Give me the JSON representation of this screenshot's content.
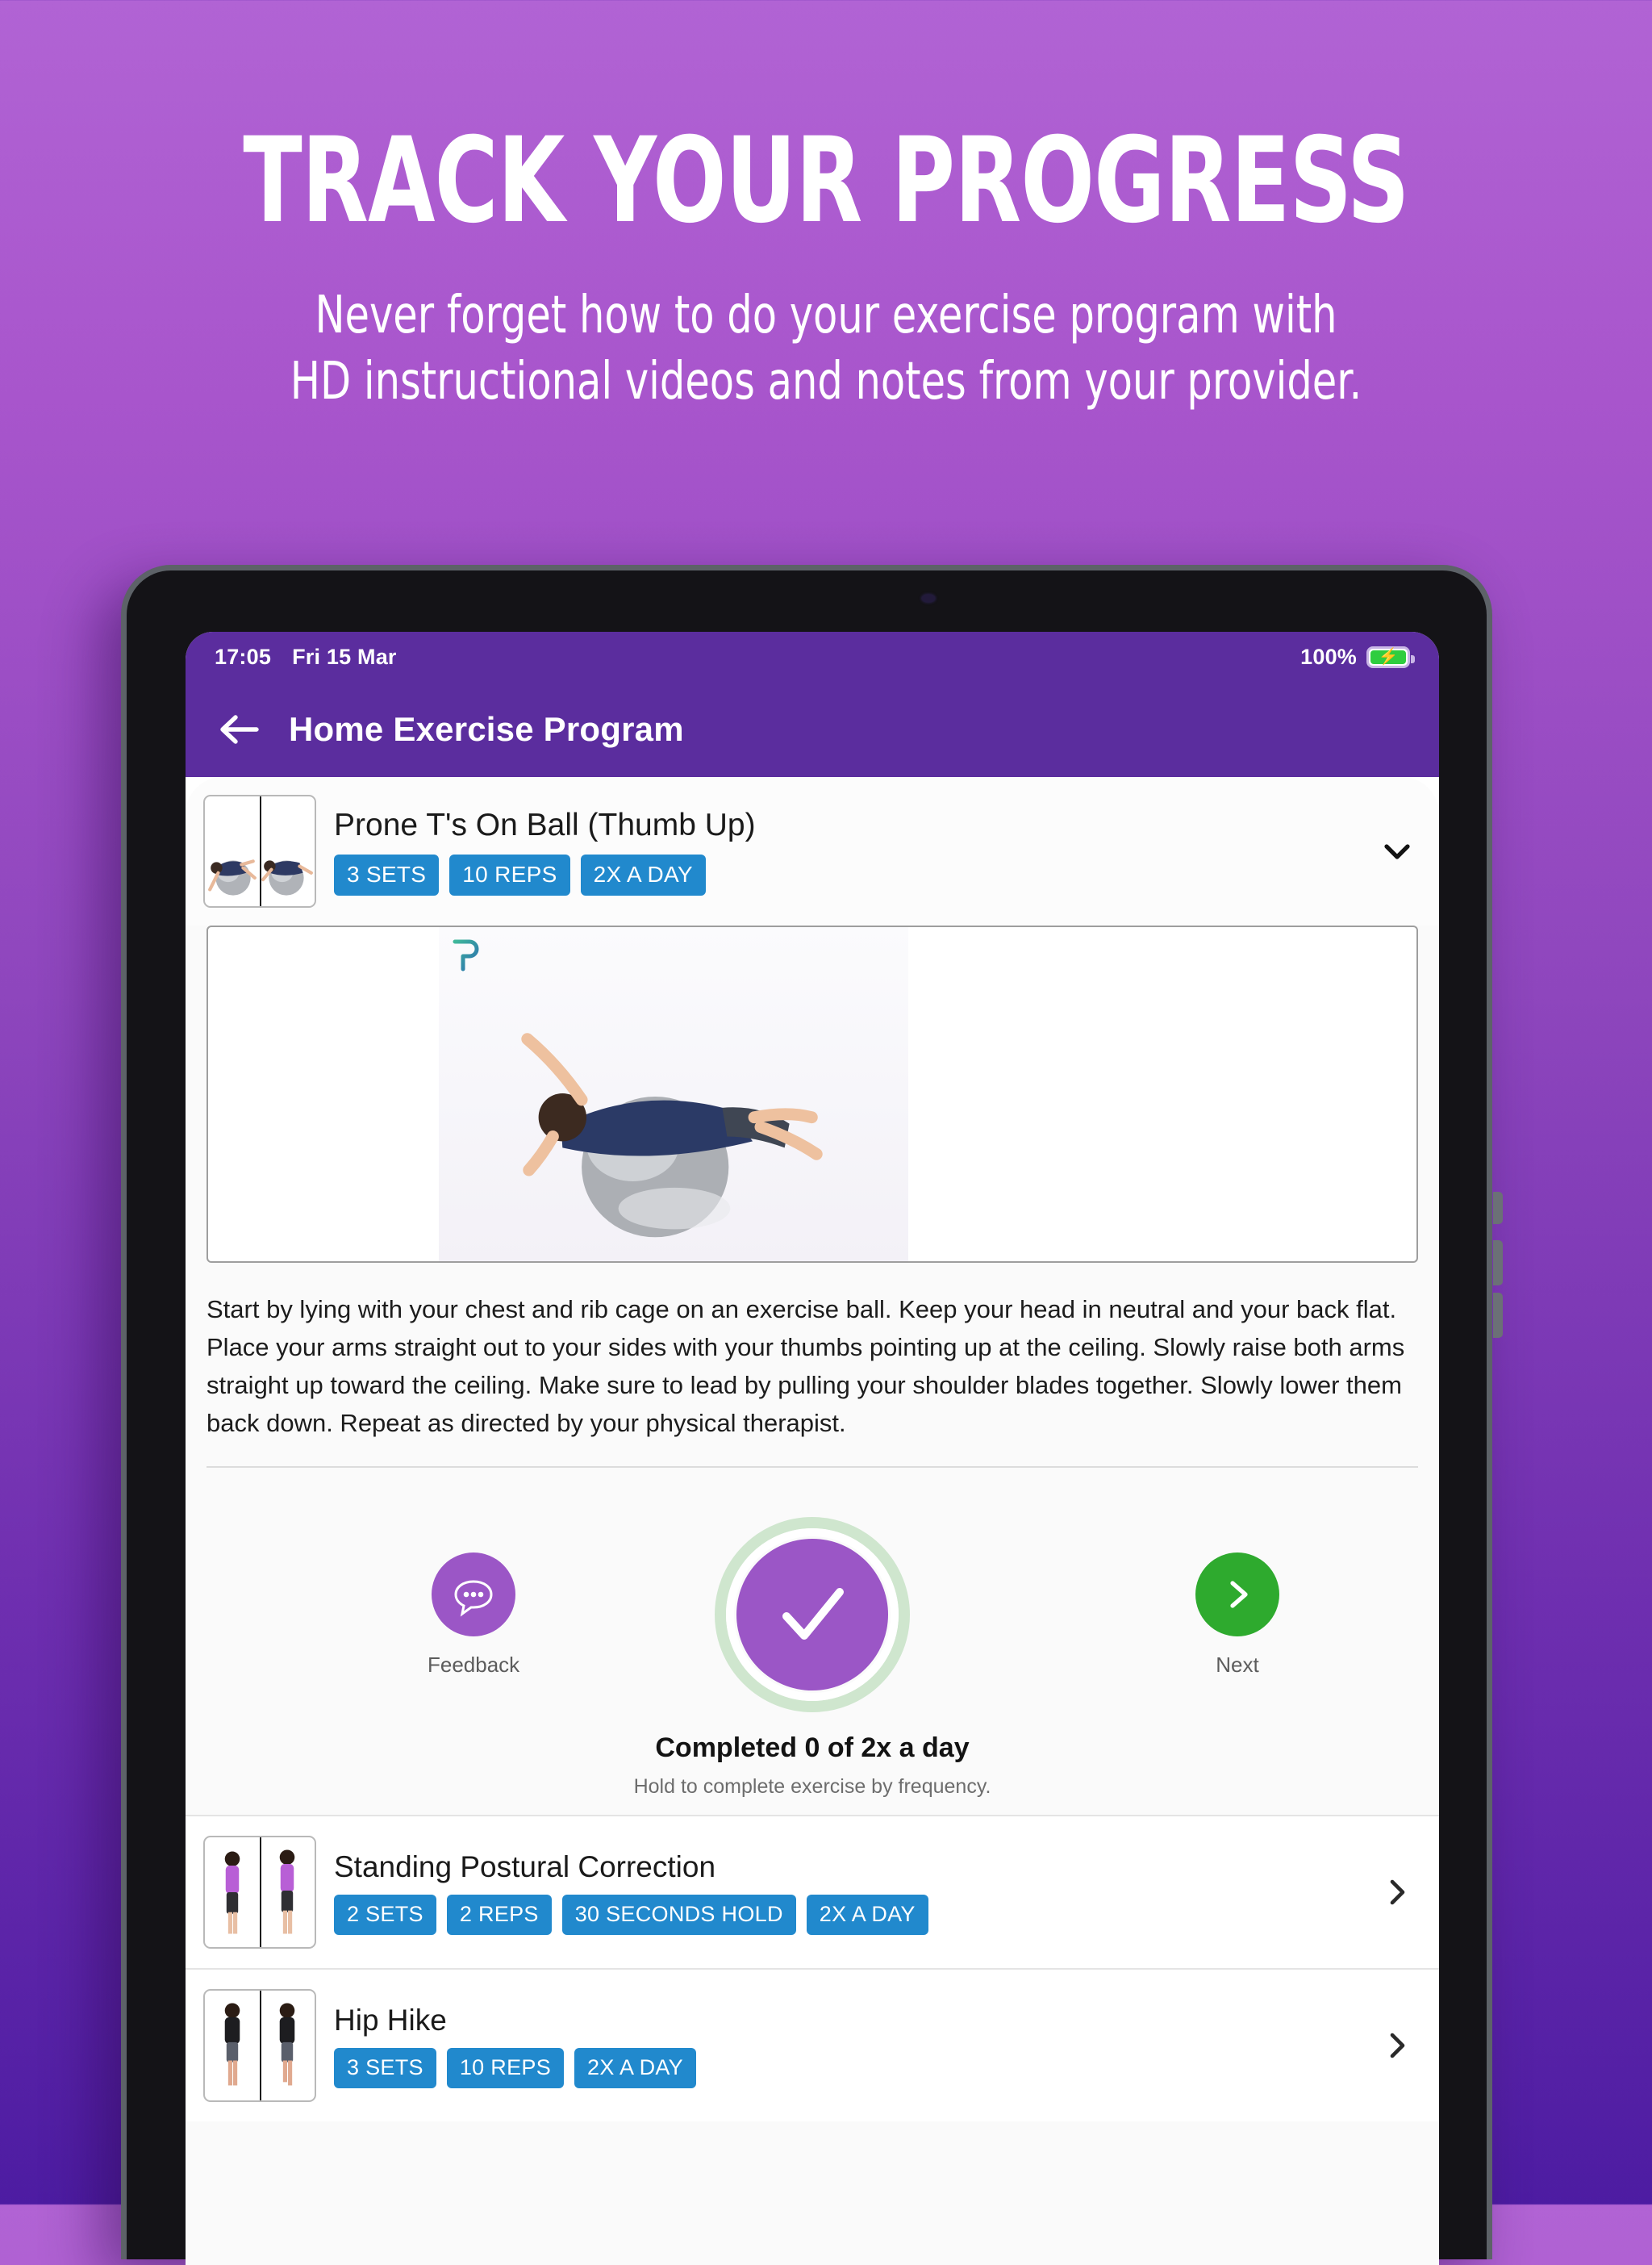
{
  "promo": {
    "title": "TRACK YOUR PROGRESS",
    "subtitle": "Never forget how to do your exercise program with\nHD instructional videos and notes from your provider."
  },
  "statusbar": {
    "time": "17:05",
    "date": "Fri 15 Mar",
    "battery_percent": "100%",
    "battery_icon": "battery-charging-icon"
  },
  "navbar": {
    "back_icon": "arrow-left-icon",
    "title": "Home Exercise Program"
  },
  "expanded_exercise": {
    "title": "Prone T's On Ball (Thumb Up)",
    "badges": [
      "3 SETS",
      "10 REPS",
      "2X A DAY"
    ],
    "expand_icon": "chevron-down-icon",
    "thumbnail_name": "prone-t-ball-thumbnail",
    "video_name": "prone-t-ball-video",
    "watermark": "physitrack-p-logo",
    "description": "Start by lying with your chest and rib cage on an exercise ball. Keep your head in neutral and your back flat. Place your arms straight out to your sides with your thumbs pointing up at the ceiling. Slowly raise both arms straight up toward the ceiling. Make sure to lead by pulling your shoulder blades together. Slowly lower them back down. Repeat as directed by your physical therapist.",
    "actions": {
      "feedback_label": "Feedback",
      "feedback_icon": "chat-bubble-icon",
      "complete_icon": "checkmark-icon",
      "next_label": "Next",
      "next_icon": "chevron-right-icon"
    },
    "completed_text": "Completed 0 of 2x a day",
    "completed_hint": "Hold to complete exercise by frequency."
  },
  "exercise_list": [
    {
      "title": "Standing Postural Correction",
      "badges": [
        "2 SETS",
        "2 REPS",
        "30 SECONDS HOLD",
        "2X A DAY"
      ],
      "chevron_icon": "chevron-right-icon",
      "thumbnail_name": "standing-postural-correction-thumbnail"
    },
    {
      "title": "Hip Hike",
      "badges": [
        "3 SETS",
        "10 REPS",
        "2X A DAY"
      ],
      "chevron_icon": "chevron-right-icon",
      "thumbnail_name": "hip-hike-thumbnail"
    }
  ],
  "colors": {
    "brand_purple": "#5b2d9e",
    "accent_purple": "#9b56c6",
    "badge_blue": "#2189cd",
    "next_green": "#2eaa2e",
    "ring_green": "#cfe6ce",
    "background_top": "#b163d4",
    "background_bottom": "#4d1ca2"
  }
}
